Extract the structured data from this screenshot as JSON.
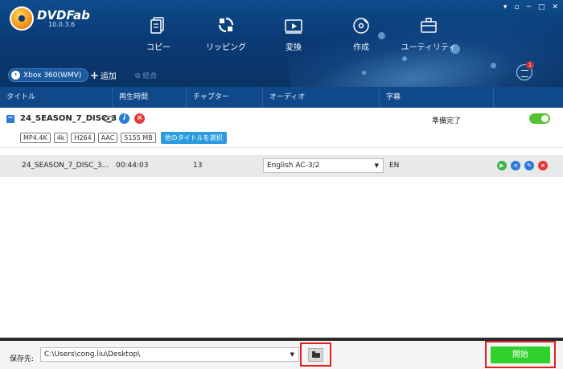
{
  "app": {
    "logo_text": "DVDFab",
    "version": "10.0.3.6"
  },
  "window_controls": [
    "▾",
    "▫",
    "─",
    "□",
    "✕"
  ],
  "nav": [
    {
      "label": "コピー",
      "icon": "copy-icon"
    },
    {
      "label": "リッピング",
      "icon": "ripper-icon"
    },
    {
      "label": "変換",
      "icon": "convert-icon"
    },
    {
      "label": "作成",
      "icon": "creator-icon"
    },
    {
      "label": "ユーティリティ",
      "icon": "utility-icon"
    }
  ],
  "toolbar": {
    "profile": "Xbox 360(WMV)",
    "add_label": "追加",
    "merge_label": "結合",
    "queue_count": "1"
  },
  "columns": [
    "タイトル",
    "再生時間",
    "チャプター",
    "オーディオ",
    "字幕"
  ],
  "title": {
    "name": "24_SEASON_7_DISC_3",
    "status": "準備完了",
    "tags": [
      "MP4.4K",
      "4k",
      "H264",
      "AAC",
      "5155 MB"
    ],
    "select_other": "他のタイトルを選択"
  },
  "track": {
    "name": "24_SEASON_7_DISC_3...",
    "duration": "00:44:03",
    "chapters": "13",
    "audio": "English AC-3/2",
    "subtitle": "EN"
  },
  "bottom": {
    "save_label": "保存先:",
    "path": "C:\\Users\\cong.liu\\Desktop\\",
    "start_label": "開始"
  },
  "colors": {
    "header": "#0a3a75",
    "start": "#2fd12a",
    "highlight": "#e02020"
  }
}
